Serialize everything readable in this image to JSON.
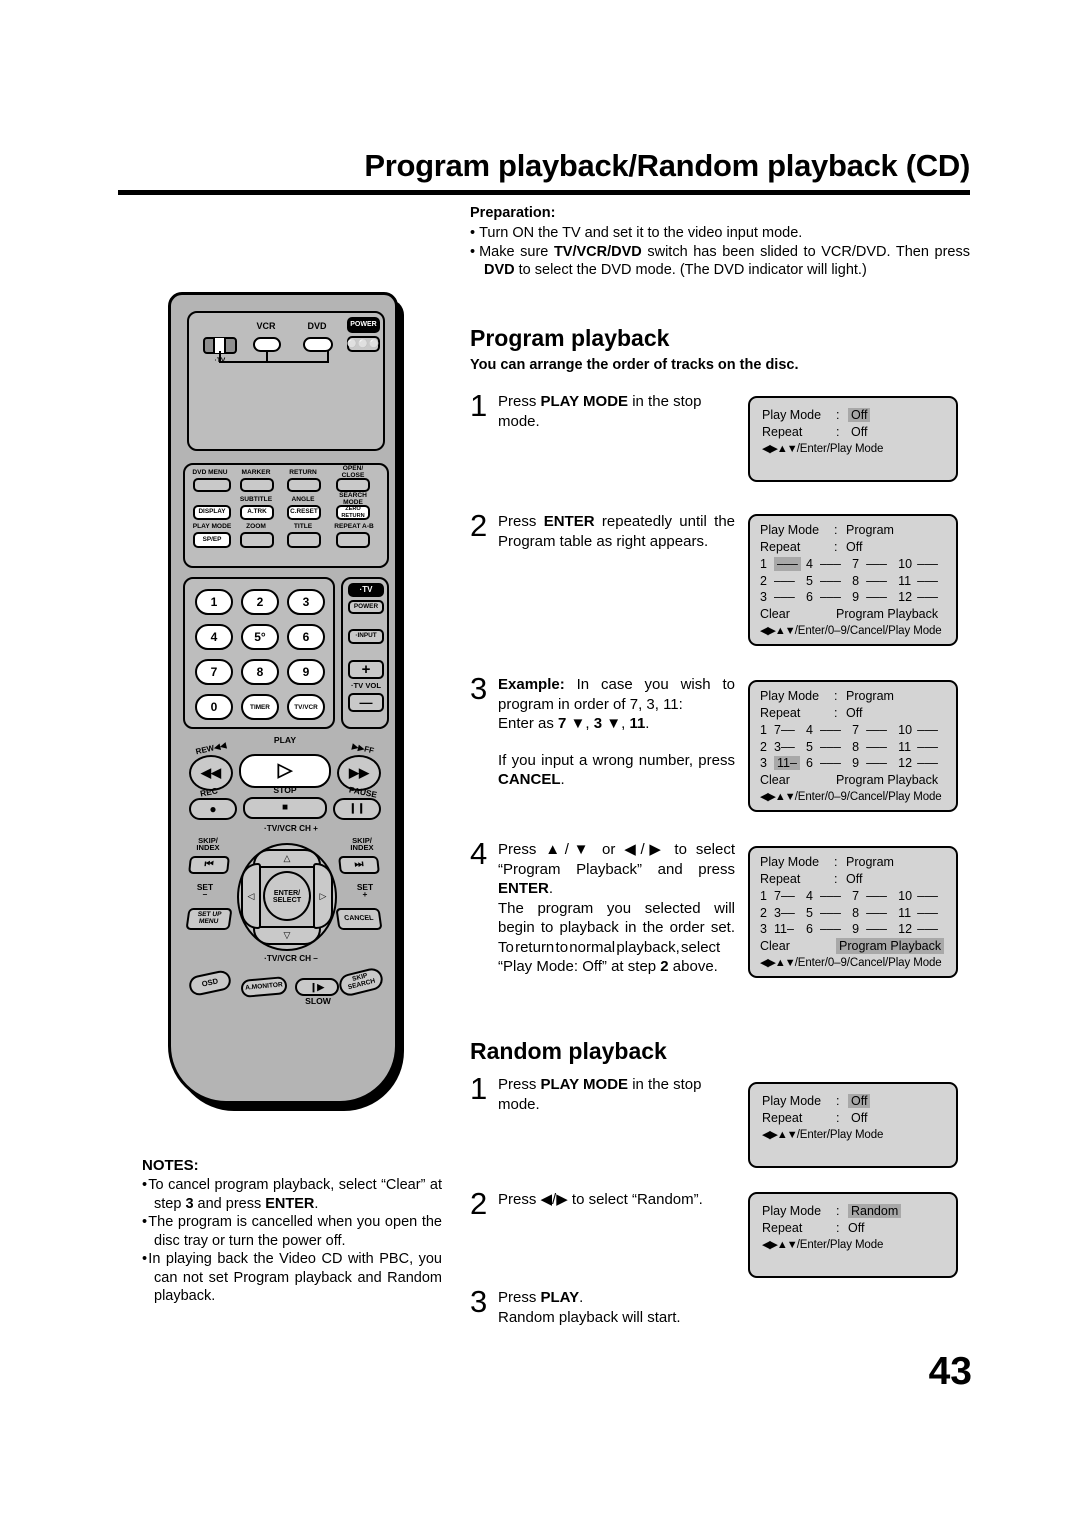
{
  "header": {
    "title": "Program playback/Random playback (CD)"
  },
  "preparation": {
    "heading": "Preparation:",
    "items": [
      "Turn ON the TV and set it to the video input mode.",
      "Make sure TV/VCR/DVD switch has been slided to VCR/DVD. Then press DVD to select the DVD mode. (The DVD indicator will light.)"
    ]
  },
  "program_section": {
    "heading": "Program playback",
    "subheading": "You can arrange the order of tracks on the disc.",
    "steps": [
      {
        "num": "1",
        "text": "Press PLAY MODE in the stop mode."
      },
      {
        "num": "2",
        "text": "Press ENTER repeatedly until the Program table as right appears."
      },
      {
        "num": "3",
        "text": "Example: In case you wish to program in order of 7, 3, 11: Enter as 7 ▼, 3 ▼, 11.",
        "text2": "If you input a wrong number, press CANCEL."
      },
      {
        "num": "4",
        "text": "Press ▲/▼ or ◀/▶ to select “Program Playback” and press ENTER.",
        "text2": "The program you selected will begin to playback in the order set. To return to normal playback, select “Play Mode: Off” at step 2 above."
      }
    ]
  },
  "random_section": {
    "heading": "Random playback",
    "steps": [
      {
        "num": "1",
        "text": "Press PLAY MODE in the stop mode."
      },
      {
        "num": "2",
        "text": "Press ◀/▶ to select “Random”."
      },
      {
        "num": "3",
        "text": "Press PLAY.",
        "text2": "Random playback will start."
      }
    ]
  },
  "osd": {
    "labels": {
      "play_mode": "Play Mode",
      "repeat": "Repeat",
      "colon": ":",
      "clear": "Clear",
      "program_playback": "Program Playback"
    },
    "hint_short": "/Enter/Play Mode",
    "hint_long": "/Enter/0–9/Cancel/Play Mode",
    "arrows": "◀▶▲▼",
    "screen1": {
      "play_mode_value": "Off",
      "repeat_value": "Off",
      "highlight": "play_mode"
    },
    "screen2": {
      "play_mode_value": "Program",
      "repeat_value": "Off",
      "tracks": [
        [
          "1",
          "–––"
        ],
        [
          "2",
          "–––"
        ],
        [
          "3",
          "–––"
        ],
        [
          "4",
          "–––"
        ],
        [
          "5",
          "–––"
        ],
        [
          "6",
          "–––"
        ],
        [
          "7",
          "–––"
        ],
        [
          "8",
          "–––"
        ],
        [
          "9",
          "–––"
        ],
        [
          "10",
          "–––"
        ],
        [
          "11",
          "–––"
        ],
        [
          "12",
          "–––"
        ]
      ],
      "highlight": "slot1"
    },
    "screen3": {
      "play_mode_value": "Program",
      "repeat_value": "Off",
      "tracks": [
        [
          "1",
          "7––"
        ],
        [
          "2",
          "3––"
        ],
        [
          "3",
          "11–"
        ],
        [
          "4",
          "–––"
        ],
        [
          "5",
          "–––"
        ],
        [
          "6",
          "–––"
        ],
        [
          "7",
          "–––"
        ],
        [
          "8",
          "–––"
        ],
        [
          "9",
          "–––"
        ],
        [
          "10",
          "–––"
        ],
        [
          "11",
          "–––"
        ],
        [
          "12",
          "–––"
        ]
      ],
      "highlight": "slot3"
    },
    "screen4": {
      "play_mode_value": "Program",
      "repeat_value": "Off",
      "tracks": [
        [
          "1",
          "7––"
        ],
        [
          "2",
          "3––"
        ],
        [
          "3",
          "11–"
        ],
        [
          "4",
          "–––"
        ],
        [
          "5",
          "–––"
        ],
        [
          "6",
          "–––"
        ],
        [
          "7",
          "–––"
        ],
        [
          "8",
          "–––"
        ],
        [
          "9",
          "–––"
        ],
        [
          "10",
          "–––"
        ],
        [
          "11",
          "–––"
        ],
        [
          "12",
          "–––"
        ]
      ],
      "highlight": "program-playback"
    },
    "screen5": {
      "play_mode_value": "Off",
      "repeat_value": "Off",
      "highlight": "play_mode"
    },
    "screen6": {
      "play_mode_value": "Random",
      "repeat_value": "Off",
      "highlight": "play_mode"
    }
  },
  "notes": {
    "heading": "NOTES:",
    "items": [
      "To cancel program playback, select “Clear” at step 3 and press ENTER.",
      "The program is cancelled when you open the disc tray or turn the power off.",
      "In playing back the Video CD with PBC, you can not set Program playback and Random playback."
    ]
  },
  "page_number": "43",
  "remote": {
    "top_labels": {
      "vcr": "VCR",
      "dvd": "DVD",
      "power": "POWER",
      "tv": "TV"
    },
    "row1": [
      "DVD MENU",
      "MARKER",
      "RETURN",
      "OPEN/\nCLOSE"
    ],
    "row2_top": [
      "SUBTITLE",
      "ANGLE",
      "SEARCH\nMODE"
    ],
    "row2": [
      "DISPLAY",
      "A.TRK",
      "C.RESET",
      "ZERO\nRETURN"
    ],
    "row3_top": [
      "PLAY MODE",
      "ZOOM",
      "TITLE",
      "REPEAT A-B"
    ],
    "row3": [
      "SP/EP"
    ],
    "numbers": [
      "1",
      "2",
      "3",
      "4",
      "5°",
      "6",
      "7",
      "8",
      "9",
      "0",
      "TIMER",
      "TV/VCR"
    ],
    "side": {
      "tv": "TV",
      "power": "POWER",
      "input": "INPUT",
      "plus": "+",
      "tvvol": "TV VOL",
      "minus": "—"
    },
    "transport": {
      "rew": "REW",
      "play": "PLAY",
      "ff": "FF",
      "rec": "REC",
      "stop": "STOP",
      "pause": "PAUSE"
    },
    "dpad": {
      "ch_up": "TV/VCR CH +",
      "ch_down": "TV/VCR CH –",
      "enter": "ENTER/\nSELECT",
      "skip_index_l": "SKIP/\nINDEX",
      "skip_index_r": "SKIP/\nINDEX",
      "set_minus": "SET\n–",
      "set_plus": "SET\n+",
      "setup_menu": "SET UP\nMENU",
      "cancel": "CANCEL"
    },
    "bottom": {
      "osd": "OSD",
      "amonitor": "A.MONITOR",
      "slow": "SLOW",
      "skip_search": "SKIP\nSEARCH"
    }
  }
}
